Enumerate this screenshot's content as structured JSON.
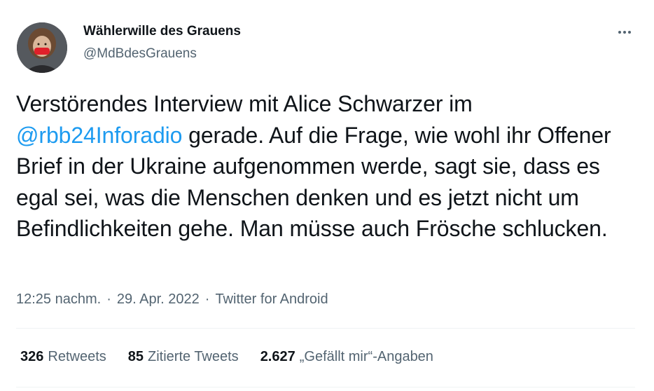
{
  "author": {
    "display_name": "Wählerwille des Grauens",
    "handle": "@MdBdesGrauens",
    "avatar_icon": "profile-photo-person-with-red-mask"
  },
  "more_icon": "more-horizontal-icon",
  "tweet": {
    "text_before_mention": "Verstörendes Interview mit Alice Schwarzer im ",
    "mention": "@rbb24Inforadio",
    "text_after_mention": " gerade. Auf die Frage, wie wohl ihr Offener Brief in der Ukraine aufgenommen werde, sagt sie, dass es egal sei, was die Menschen denken und es jetzt nicht um Befindlichkeiten gehe. Man müsse auch Frösche schlucken.",
    "mention_color": "#1d9bf0"
  },
  "meta": {
    "time": "12:25 nachm.",
    "separator1": "·",
    "date": "29. Apr. 2022",
    "separator2": "·",
    "source": "Twitter for Android"
  },
  "stats": {
    "retweets_count": "326",
    "retweets_label": "Retweets",
    "quotes_count": "85",
    "quotes_label": "Zitierte Tweets",
    "likes_count": "2.627",
    "likes_label": "„Gefällt mir“-Angaben"
  }
}
